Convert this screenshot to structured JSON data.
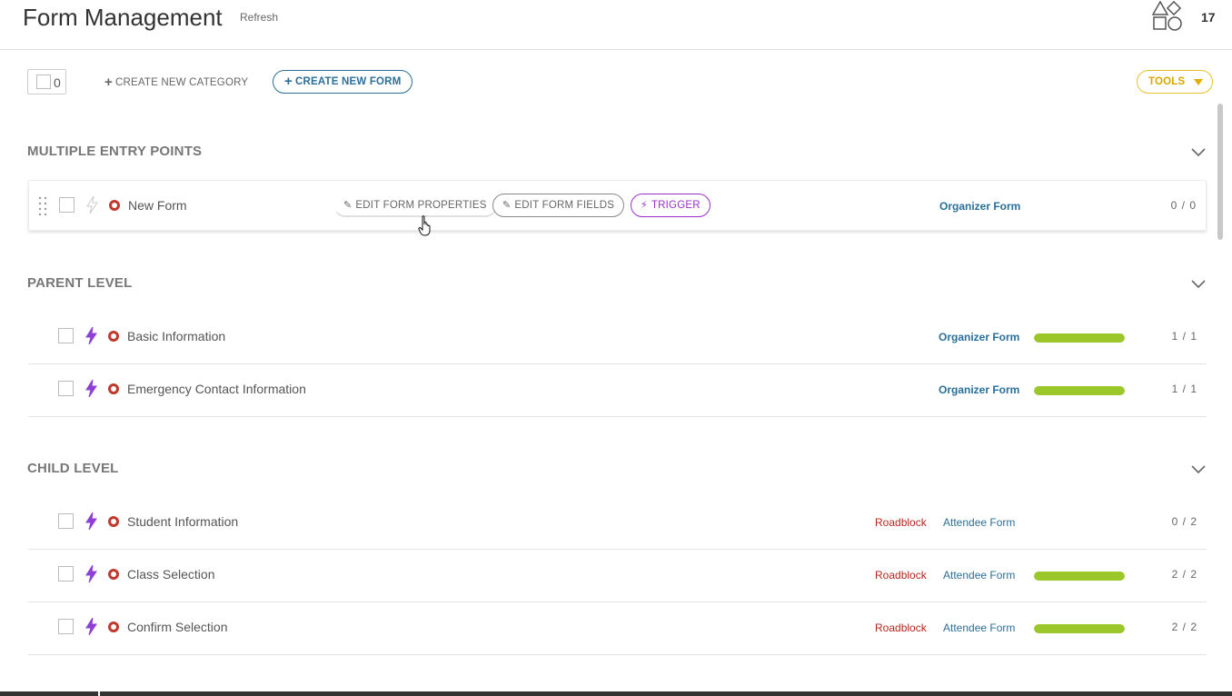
{
  "header": {
    "title": "Form Management",
    "refresh_label": "Refresh",
    "shapes_icon": "shapes-icon",
    "count": "17"
  },
  "toolbar": {
    "select_all_count": "0",
    "create_category_label": "CREATE NEW CATEGORY",
    "create_form_label": "CREATE NEW FORM",
    "tools_label": "TOOLS"
  },
  "actions": {
    "edit_properties_label": "EDIT FORM PROPERTIES",
    "edit_fields_label": "EDIT FORM FIELDS",
    "trigger_label": "TRIGGER"
  },
  "colors": {
    "accent_blue": "#2a6f97",
    "tools_yellow": "#e8c130",
    "trigger_purple": "#9b30c9",
    "status_red": "#c0392b",
    "progress_green": "#9bc72b"
  },
  "sections": [
    {
      "title": "MULTIPLE ENTRY POINTS",
      "rows": [
        {
          "name": "New Form",
          "roadblock": "",
          "form_type": "Organizer Form",
          "progress": null,
          "count": "0 / 0",
          "bolt_active": false
        }
      ]
    },
    {
      "title": "PARENT LEVEL",
      "rows": [
        {
          "name": "Basic Information",
          "roadblock": "",
          "form_type": "Organizer Form",
          "progress": 1.0,
          "count": "1 / 1",
          "bolt_active": true
        },
        {
          "name": "Emergency Contact Information",
          "roadblock": "",
          "form_type": "Organizer Form",
          "progress": 1.0,
          "count": "1 / 1",
          "bolt_active": true
        }
      ]
    },
    {
      "title": "CHILD LEVEL",
      "rows": [
        {
          "name": "Student Information",
          "roadblock": "Roadblock",
          "form_type": "Attendee Form",
          "progress": null,
          "count": "0 / 2",
          "bolt_active": true
        },
        {
          "name": "Class Selection",
          "roadblock": "Roadblock",
          "form_type": "Attendee Form",
          "progress": 1.0,
          "count": "2 / 2",
          "bolt_active": true
        },
        {
          "name": "Confirm Selection",
          "roadblock": "Roadblock",
          "form_type": "Attendee Form",
          "progress": 1.0,
          "count": "2 / 2",
          "bolt_active": true
        }
      ]
    }
  ]
}
